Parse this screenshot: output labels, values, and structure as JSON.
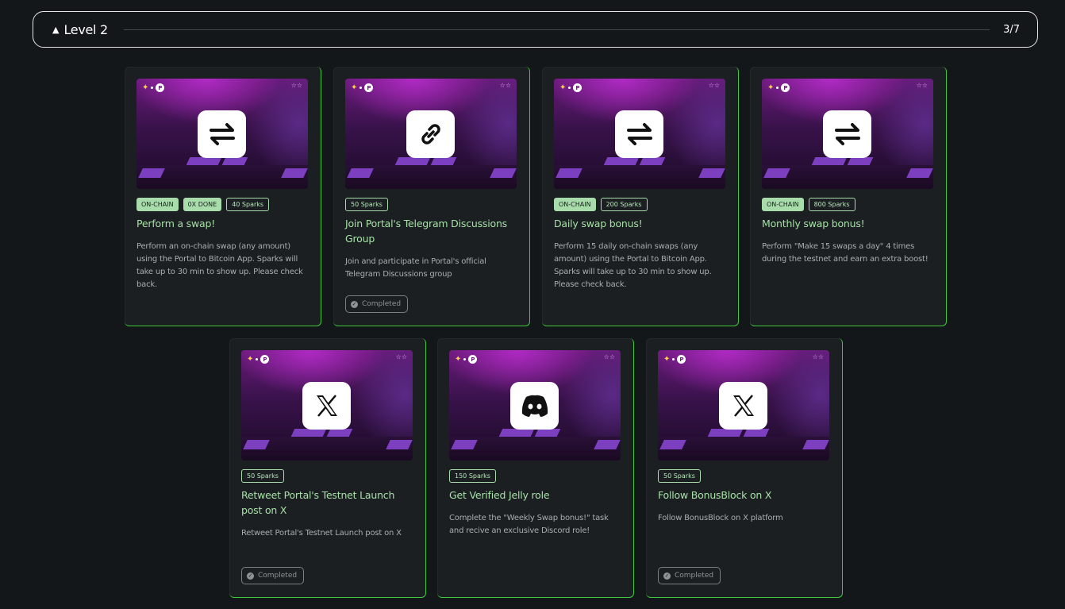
{
  "level": {
    "title": "Level 2",
    "progress": "3/7",
    "collapse_icon": "triangle-up-icon"
  },
  "cards": [
    {
      "icon": "swap-arrows-icon",
      "tags": [
        "ON-CHAIN",
        "0X DONE",
        "40 Sparks"
      ],
      "title": "Perform a swap!",
      "description": "Perform an on-chain swap (any amount) using the Portal to Bitcoin App. Sparks will take up to 30 min to show up. Please check back."
    },
    {
      "icon": "link-icon",
      "tags": [
        "50 Sparks"
      ],
      "title": "Join Portal's Telegram Discussions Group",
      "description": "Join and participate in Portal's official Telegram Discussions group",
      "status": "Completed"
    },
    {
      "icon": "swap-arrows-icon",
      "tags": [
        "ON-CHAIN",
        "200 Sparks"
      ],
      "title": "Daily swap bonus!",
      "description": "Perform 15 daily on-chain swaps (any amount) using the Portal to Bitcoin App. Sparks will take up to 30 min to show up. Please check back."
    },
    {
      "icon": "swap-arrows-icon",
      "tags": [
        "ON-CHAIN",
        "800 Sparks"
      ],
      "title": "Monthly swap bonus!",
      "description": "Perform \"Make 15 swaps a day\" 4 times during the testnet and earn an extra boost!"
    },
    {
      "icon": "x-logo-icon",
      "tags": [
        "50 Sparks"
      ],
      "title": "Retweet Portal's Testnet Launch post on X",
      "description": "Retweet Portal's Testnet Launch post on X",
      "status": "Completed"
    },
    {
      "icon": "discord-icon",
      "tags": [
        "150 Sparks"
      ],
      "title": "Get Verified Jelly role",
      "description": "Complete the \"Weekly Swap bonus!\" task and recive an exclusive Discord role!"
    },
    {
      "icon": "x-logo-icon",
      "tags": [
        "50 Sparks"
      ],
      "title": "Follow BonusBlock on X",
      "description": "Follow BonusBlock on X platform",
      "status": "Completed"
    }
  ],
  "colors": {
    "accent_green": "#3ec93c",
    "tag_green": "#a8dcaa",
    "title_green": "#a6e0a6",
    "background": "#131719",
    "card": "#1b1f22"
  }
}
